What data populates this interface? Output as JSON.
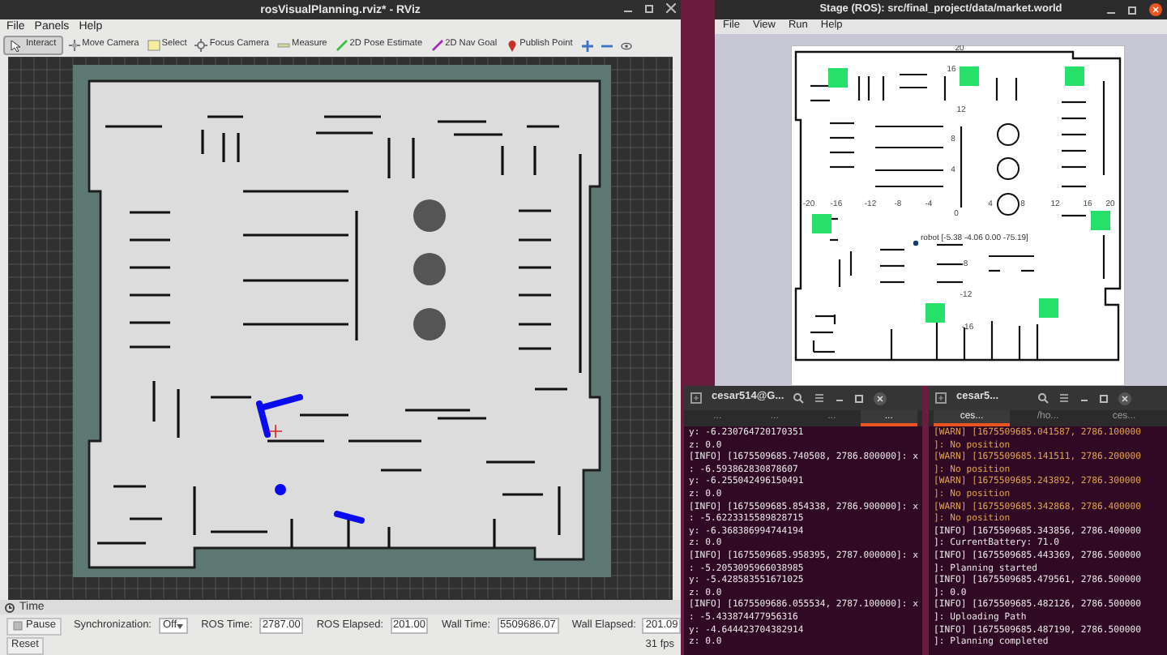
{
  "rviz": {
    "title": "rosVisualPlanning.rviz* - RViz",
    "menu": [
      "File",
      "Panels",
      "Help"
    ],
    "tools": [
      {
        "label": "Interact",
        "kind": "interact",
        "selected": true
      },
      {
        "label": "Move Camera",
        "kind": "move",
        "selected": false
      },
      {
        "label": "Select",
        "kind": "select",
        "selected": false
      },
      {
        "label": "Focus Camera",
        "kind": "focus",
        "selected": false
      },
      {
        "label": "Measure",
        "kind": "measure",
        "selected": false
      },
      {
        "label": "2D Pose Estimate",
        "kind": "pose",
        "selected": false
      },
      {
        "label": "2D Nav Goal",
        "kind": "goal",
        "selected": false
      },
      {
        "label": "Publish Point",
        "kind": "point",
        "selected": false
      }
    ],
    "time_panel": {
      "title": "Time",
      "pause": "Pause",
      "sync_label": "Synchronization:",
      "sync_value": "Off",
      "fields": [
        {
          "label": "ROS Time:",
          "value": "2787.00"
        },
        {
          "label": "ROS Elapsed:",
          "value": "201.00"
        },
        {
          "label": "Wall Time:",
          "value": "5509686.07"
        },
        {
          "label": "Wall Elapsed:",
          "value": "201.09"
        }
      ],
      "reset": "Reset",
      "fps": "31 fps"
    }
  },
  "stage": {
    "title": "Stage (ROS): src/final_project/data/market.world",
    "menu": [
      "File",
      "View",
      "Run",
      "Help"
    ],
    "axis_labels": [
      "20",
      "16",
      "12",
      "8",
      "4",
      "-20",
      "-16",
      "-12",
      "-8",
      "-4",
      "0",
      "4",
      "8",
      "12",
      "16",
      "20",
      "-8",
      "-12",
      "-16"
    ],
    "robot_label": "robot [-5.38 -4.06 0.00 -75.19]"
  },
  "terminals": [
    {
      "title": "cesar514@G...",
      "tabs": [
        {
          "label": "...",
          "selected": false
        },
        {
          "label": "...",
          "selected": false
        },
        {
          "label": "...",
          "selected": false
        },
        {
          "label": "...",
          "selected": true
        }
      ],
      "lines": [
        {
          "kind": "info",
          "text": "y: -6.230764720170351"
        },
        {
          "kind": "info",
          "text": "z: 0.0"
        },
        {
          "kind": "info",
          "text": "[INFO] [1675509685.740508, 2786.800000]: x"
        },
        {
          "kind": "info",
          "text": ": -6.593862830878607"
        },
        {
          "kind": "info",
          "text": "y: -6.255042496150491"
        },
        {
          "kind": "info",
          "text": "z: 0.0"
        },
        {
          "kind": "info",
          "text": "[INFO] [1675509685.854338, 2786.900000]: x"
        },
        {
          "kind": "info",
          "text": ": -5.6223315589828715"
        },
        {
          "kind": "info",
          "text": "y: -6.368386994744194"
        },
        {
          "kind": "info",
          "text": "z: 0.0"
        },
        {
          "kind": "info",
          "text": "[INFO] [1675509685.958395, 2787.000000]: x"
        },
        {
          "kind": "info",
          "text": ": -5.2053095966038985"
        },
        {
          "kind": "info",
          "text": "y: -5.428583551671025"
        },
        {
          "kind": "info",
          "text": "z: 0.0"
        },
        {
          "kind": "info",
          "text": "[INFO] [1675509686.055534, 2787.100000]: x"
        },
        {
          "kind": "info",
          "text": ": -5.433874477956316"
        },
        {
          "kind": "info",
          "text": "y: -4.644423704382914"
        },
        {
          "kind": "info",
          "text": "z: 0.0"
        }
      ]
    },
    {
      "title": "cesar5...",
      "tabs": [
        {
          "label": "ces...",
          "selected": true
        },
        {
          "label": "/ho...",
          "selected": false
        },
        {
          "label": "ces...",
          "selected": false
        }
      ],
      "lines": [
        {
          "kind": "warn",
          "text": "[WARN] [1675509685.041587, 2786.100000"
        },
        {
          "kind": "warn",
          "text": "]: No position"
        },
        {
          "kind": "warn",
          "text": "[WARN] [1675509685.141511, 2786.200000"
        },
        {
          "kind": "warn",
          "text": "]: No position"
        },
        {
          "kind": "warn",
          "text": "[WARN] [1675509685.243892, 2786.300000"
        },
        {
          "kind": "warn",
          "text": "]: No position"
        },
        {
          "kind": "warn",
          "text": "[WARN] [1675509685.342868, 2786.400000"
        },
        {
          "kind": "warn",
          "text": "]: No position"
        },
        {
          "kind": "info",
          "text": "[INFO] [1675509685.343856, 2786.400000"
        },
        {
          "kind": "info",
          "text": "]: CurrentBattery: 71.0"
        },
        {
          "kind": "info",
          "text": "[INFO] [1675509685.443369, 2786.500000"
        },
        {
          "kind": "info",
          "text": "]: Planning started"
        },
        {
          "kind": "info",
          "text": "[INFO] [1675509685.479561, 2786.500000"
        },
        {
          "kind": "info",
          "text": "]: 0.0"
        },
        {
          "kind": "info",
          "text": "[INFO] [1675509685.482126, 2786.500000"
        },
        {
          "kind": "info",
          "text": "]: Uploading Path"
        },
        {
          "kind": "info",
          "text": "[INFO] [1675509685.487190, 2786.500000"
        },
        {
          "kind": "info",
          "text": "]: Planning completed"
        }
      ]
    }
  ]
}
